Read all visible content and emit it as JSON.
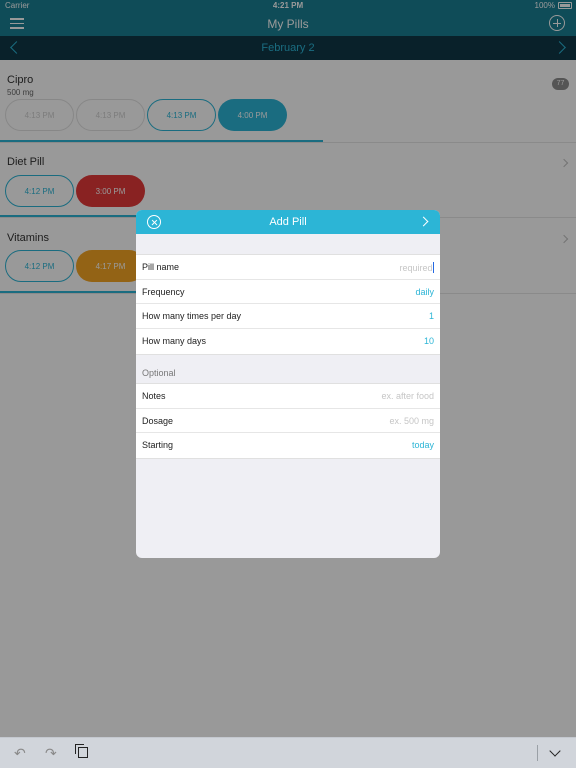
{
  "status": {
    "carrier": "Carrier",
    "time": "4:21 PM",
    "battery": "100%"
  },
  "nav": {
    "title": "My Pills"
  },
  "date_bar": {
    "date": "February 2"
  },
  "pills": [
    {
      "name": "Cipro",
      "dosage": "500 mg",
      "badge": "77",
      "doses": [
        "4:13 PM",
        "4:13 PM",
        "4:13 PM",
        "4:00 PM"
      ],
      "progress": 0.56
    },
    {
      "name": "Diet Pill",
      "doses": [
        "4:12 PM",
        "3:00 PM"
      ],
      "progress": 0.24
    },
    {
      "name": "Vitamins",
      "doses": [
        "4:12 PM",
        "4:17 PM"
      ],
      "progress": 0.24
    }
  ],
  "modal": {
    "title": "Add Pill",
    "fields": [
      {
        "label": "Pill name",
        "placeholder": "required"
      },
      {
        "label": "Frequency",
        "value": "daily"
      },
      {
        "label": "How many times per day",
        "value": "1"
      },
      {
        "label": "How many days",
        "value": "10"
      }
    ],
    "optional_label": "Optional",
    "optional_fields": [
      {
        "label": "Notes",
        "placeholder": "ex. after food"
      },
      {
        "label": "Dosage",
        "placeholder": "ex. 500 mg"
      },
      {
        "label": "Starting",
        "value": "today"
      }
    ]
  },
  "colors": {
    "teal": "#2cb5d6",
    "header": "#1a7f93",
    "datebar": "#0f3847",
    "missed": "#e53939",
    "late": "#f5a623"
  }
}
